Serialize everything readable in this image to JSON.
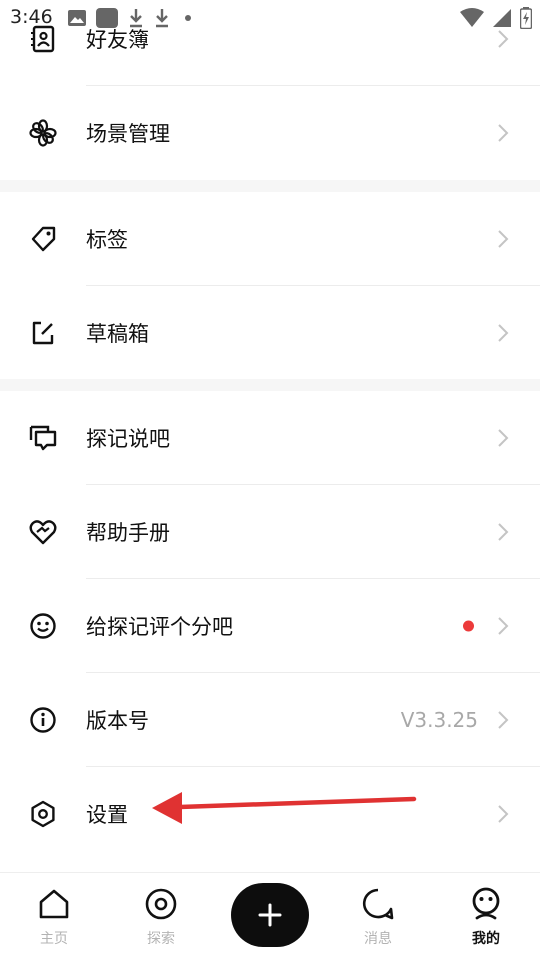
{
  "status_bar": {
    "time": "3:46"
  },
  "menu": {
    "items": [
      {
        "label": "好友簿",
        "icon": "address-book-icon"
      },
      {
        "label": "场景管理",
        "icon": "flower-icon"
      },
      {
        "label": "标签",
        "icon": "tag-icon"
      },
      {
        "label": "草稿箱",
        "icon": "draft-edit-icon"
      },
      {
        "label": "探记说吧",
        "icon": "chat-bubbles-icon"
      },
      {
        "label": "帮助手册",
        "icon": "heart-hands-icon"
      },
      {
        "label": "给探记评个分吧",
        "icon": "smile-icon",
        "has_red_dot": true
      },
      {
        "label": "版本号",
        "icon": "info-icon",
        "value": "V3.3.25"
      },
      {
        "label": "设置",
        "icon": "settings-hex-icon"
      }
    ]
  },
  "annotation": {
    "color": "#e03232"
  },
  "tabbar": {
    "tabs": [
      {
        "label": "主页",
        "icon": "home-icon",
        "active": false
      },
      {
        "label": "探索",
        "icon": "explore-target-icon",
        "active": false
      },
      {
        "label": "",
        "icon": "plus-icon"
      },
      {
        "label": "消息",
        "icon": "message-bubble-icon",
        "active": false
      },
      {
        "label": "我的",
        "icon": "profile-face-icon",
        "active": true
      }
    ]
  }
}
